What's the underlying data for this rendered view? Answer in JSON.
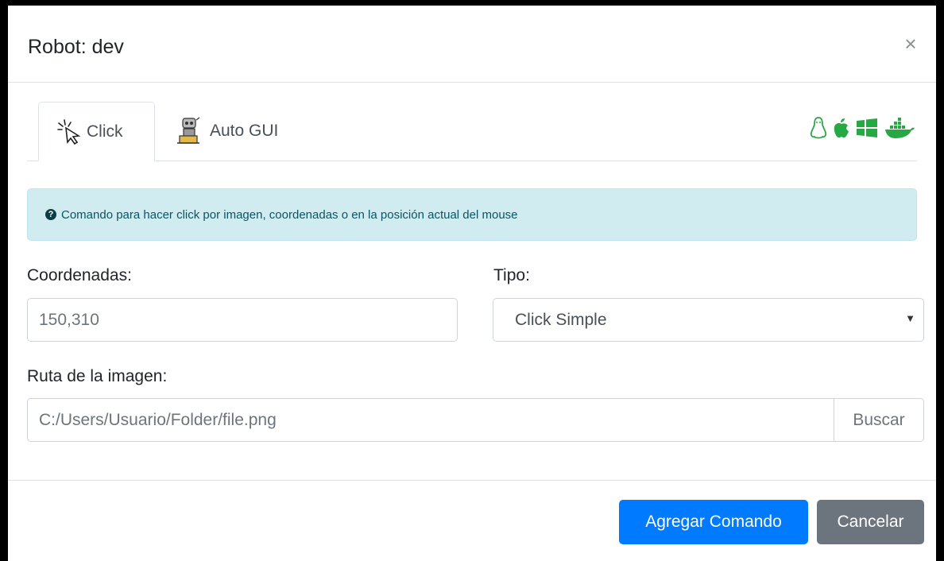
{
  "modal": {
    "title": "Robot: dev",
    "close_symbol": "×"
  },
  "tabs": [
    {
      "label": "Click",
      "icon": "cursor-click-icon",
      "active": true
    },
    {
      "label": "Auto GUI",
      "icon": "robot-icon",
      "active": false
    }
  ],
  "os_icons": [
    "linux-icon",
    "apple-icon",
    "windows-icon",
    "docker-icon"
  ],
  "alert": {
    "text": "Comando para hacer click por imagen, coordenadas o en la posición actual del mouse"
  },
  "form": {
    "coordinates_label": "Coordenadas:",
    "coordinates_placeholder": "150,310",
    "type_label": "Tipo:",
    "type_selected": "Click Simple",
    "image_path_label": "Ruta de la imagen:",
    "image_path_placeholder": "C:/Users/Usuario/Folder/file.png",
    "browse_label": "Buscar"
  },
  "footer": {
    "add_label": "Agregar Comando",
    "cancel_label": "Cancelar"
  },
  "colors": {
    "primary": "#007bff",
    "secondary": "#6c757d",
    "alert_bg": "#d1ecf1",
    "os_icon_green": "#28a745"
  }
}
